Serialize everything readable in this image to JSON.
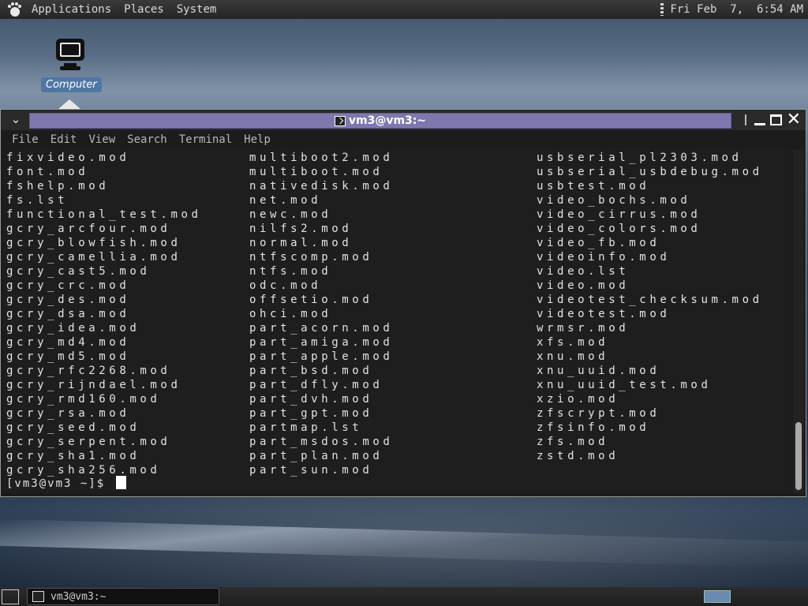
{
  "top_panel": {
    "menus": [
      "Applications",
      "Places",
      "System"
    ],
    "clock": "Fri Feb  7,  6:54 AM"
  },
  "desktop": {
    "icons": [
      {
        "label": "Computer",
        "icon": "computer-icon"
      }
    ]
  },
  "window": {
    "title": "vm3@vm3:~",
    "menus": [
      "File",
      "Edit",
      "View",
      "Search",
      "Terminal",
      "Help"
    ],
    "terminal": {
      "rows": [
        [
          "fixvideo.mod",
          "multiboot2.mod",
          "usbserial_pl2303.mod"
        ],
        [
          "font.mod",
          "multiboot.mod",
          "usbserial_usbdebug.mod"
        ],
        [
          "fshelp.mod",
          "nativedisk.mod",
          "usbtest.mod"
        ],
        [
          "fs.lst",
          "net.mod",
          "video_bochs.mod"
        ],
        [
          "functional_test.mod",
          "newc.mod",
          "video_cirrus.mod"
        ],
        [
          "gcry_arcfour.mod",
          "nilfs2.mod",
          "video_colors.mod"
        ],
        [
          "gcry_blowfish.mod",
          "normal.mod",
          "video_fb.mod"
        ],
        [
          "gcry_camellia.mod",
          "ntfscomp.mod",
          "videoinfo.mod"
        ],
        [
          "gcry_cast5.mod",
          "ntfs.mod",
          "video.lst"
        ],
        [
          "gcry_crc.mod",
          "odc.mod",
          "video.mod"
        ],
        [
          "gcry_des.mod",
          "offsetio.mod",
          "videotest_checksum.mod"
        ],
        [
          "gcry_dsa.mod",
          "ohci.mod",
          "videotest.mod"
        ],
        [
          "gcry_idea.mod",
          "part_acorn.mod",
          "wrmsr.mod"
        ],
        [
          "gcry_md4.mod",
          "part_amiga.mod",
          "xfs.mod"
        ],
        [
          "gcry_md5.mod",
          "part_apple.mod",
          "xnu.mod"
        ],
        [
          "gcry_rfc2268.mod",
          "part_bsd.mod",
          "xnu_uuid.mod"
        ],
        [
          "gcry_rijndael.mod",
          "part_dfly.mod",
          "xnu_uuid_test.mod"
        ],
        [
          "gcry_rmd160.mod",
          "part_dvh.mod",
          "xzio.mod"
        ],
        [
          "gcry_rsa.mod",
          "part_gpt.mod",
          "zfscrypt.mod"
        ],
        [
          "gcry_seed.mod",
          "partmap.lst",
          "zfsinfo.mod"
        ],
        [
          "gcry_serpent.mod",
          "part_msdos.mod",
          "zfs.mod"
        ],
        [
          "gcry_sha1.mod",
          "part_plan.mod",
          "zstd.mod"
        ],
        [
          "gcry_sha256.mod",
          "part_sun.mod",
          ""
        ]
      ],
      "prompt": "[vm3@vm3 ~]$"
    }
  },
  "bottom_panel": {
    "task_label": "vm3@vm3:~"
  },
  "colors": {
    "title_active": "#7d79ae",
    "terminal_bg": "#1e1e1e",
    "terminal_fg": "#e3e3e3",
    "desktop_selection": "#4f77a6"
  }
}
